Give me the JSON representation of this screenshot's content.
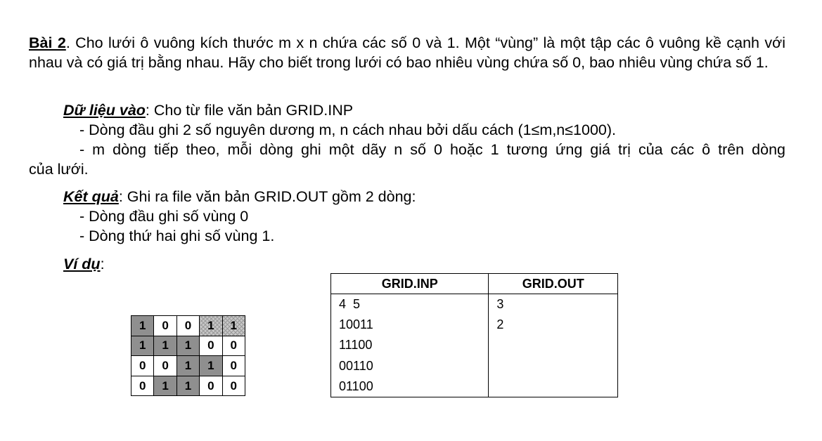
{
  "problem": {
    "label": "Bài 2",
    "statement": ". Cho lưới ô vuông kích thước m x n chứa các số 0 và 1. Một “vùng” là một tập các ô vuông kề cạnh với nhau và có giá trị bằng nhau. Hãy cho biết trong lưới có bao nhiêu vùng chứa số 0, bao nhiêu vùng chứa số 1."
  },
  "input_section": {
    "heading": "Dữ liệu vào",
    "intro": ": Cho từ file văn bản GRID.INP",
    "line1": "- Dòng đầu ghi 2 số nguyên dương m, n cách nhau bởi dấu cách (1≤m,n≤1000).",
    "line2_part1": "- m dòng tiếp theo, mỗi dòng ghi một dãy n số 0 hoặc 1 tương ứng giá trị của các ô trên dòng",
    "line2_part2": "của lưới."
  },
  "output_section": {
    "heading": "Kết quả",
    "intro": ": Ghi ra file văn bản GRID.OUT gồm 2 dòng:",
    "line1": "- Dòng đầu ghi số vùng 0",
    "line2": "- Dòng thứ hai ghi số vùng 1."
  },
  "example": {
    "heading": "Ví dụ",
    "colon": ":",
    "grid": [
      [
        "1",
        "0",
        "0",
        "1",
        "1"
      ],
      [
        "1",
        "1",
        "1",
        "0",
        "0"
      ],
      [
        "0",
        "0",
        "1",
        "1",
        "0"
      ],
      [
        "0",
        "1",
        "1",
        "0",
        "0"
      ]
    ],
    "grid_shading": [
      [
        "dark",
        "",
        "",
        "hatch",
        "hatch"
      ],
      [
        "dark",
        "dark",
        "dark",
        "",
        ""
      ],
      [
        "",
        "",
        "dark",
        "dark",
        ""
      ],
      [
        "",
        "dark",
        "dark",
        "",
        ""
      ]
    ],
    "table": {
      "header_inp": "GRID.INP",
      "header_out": "GRID.OUT",
      "rows": [
        [
          "4  5",
          "3"
        ],
        [
          "10011",
          "2"
        ],
        [
          "11100",
          ""
        ],
        [
          "00110",
          ""
        ],
        [
          "01100",
          ""
        ]
      ]
    }
  },
  "colors": {
    "dark_cell": "#8f8f8f",
    "hatch_cell": "#c8c8c8"
  }
}
